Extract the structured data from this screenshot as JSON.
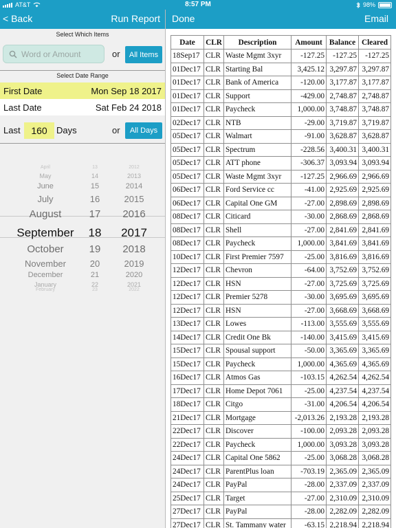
{
  "status": {
    "carrier": "AT&T",
    "time": "8:57 PM",
    "battery": "98%"
  },
  "left_nav": {
    "back": "< Back",
    "run_report": "Run Report"
  },
  "right_nav": {
    "done": "Done",
    "email": "Email"
  },
  "select_items": {
    "label": "Select Which Items",
    "placeholder": "Word or Amount",
    "or": "or",
    "all_items": "All Items"
  },
  "date_range": {
    "label": "Select Date Range",
    "first_label": "First Date",
    "first_value": "Mon Sep 18 2017",
    "last_label": "Last Date",
    "last_value": "Sat Feb 24 2018"
  },
  "last_days": {
    "prefix": "Last",
    "value": "160",
    "suffix": "Days",
    "or": "or",
    "all_days": "All Days"
  },
  "picker": {
    "months": [
      "April",
      "May",
      "June",
      "July",
      "August",
      "September",
      "October",
      "November",
      "December",
      "January",
      "February"
    ],
    "days": [
      "13",
      "14",
      "15",
      "16",
      "17",
      "18",
      "19",
      "20",
      "21",
      "22",
      "23"
    ],
    "years": [
      "2012",
      "2013",
      "2014",
      "2015",
      "2016",
      "2017",
      "2018",
      "2019",
      "2020",
      "2021",
      "2022"
    ]
  },
  "table": {
    "headers": [
      "Date",
      "CLR",
      "Description",
      "Amount",
      "Balance",
      "Cleared"
    ],
    "rows": [
      [
        "18Sep17",
        "CLR",
        "Waste Mgmt 3xyr",
        "-127.25",
        "-127.25",
        "-127.25"
      ],
      [
        "01Dec17",
        "CLR",
        "Starting Bal",
        "3,425.12",
        "3,297.87",
        "3,297.87"
      ],
      [
        "01Dec17",
        "CLR",
        "Bank of America",
        "-120.00",
        "3,177.87",
        "3,177.87"
      ],
      [
        "01Dec17",
        "CLR",
        "Support",
        "-429.00",
        "2,748.87",
        "2,748.87"
      ],
      [
        "01Dec17",
        "CLR",
        "Paycheck",
        "1,000.00",
        "3,748.87",
        "3,748.87"
      ],
      [
        "02Dec17",
        "CLR",
        "NTB",
        "-29.00",
        "3,719.87",
        "3,719.87"
      ],
      [
        "05Dec17",
        "CLR",
        "Walmart",
        "-91.00",
        "3,628.87",
        "3,628.87"
      ],
      [
        "05Dec17",
        "CLR",
        "Spectrum",
        "-228.56",
        "3,400.31",
        "3,400.31"
      ],
      [
        "05Dec17",
        "CLR",
        "ATT phone",
        "-306.37",
        "3,093.94",
        "3,093.94"
      ],
      [
        "05Dec17",
        "CLR",
        "Waste Mgmt 3xyr",
        "-127.25",
        "2,966.69",
        "2,966.69"
      ],
      [
        "06Dec17",
        "CLR",
        "Ford Service cc",
        "-41.00",
        "2,925.69",
        "2,925.69"
      ],
      [
        "06Dec17",
        "CLR",
        "Capital One GM",
        "-27.00",
        "2,898.69",
        "2,898.69"
      ],
      [
        "08Dec17",
        "CLR",
        "Citicard",
        "-30.00",
        "2,868.69",
        "2,868.69"
      ],
      [
        "08Dec17",
        "CLR",
        "Shell",
        "-27.00",
        "2,841.69",
        "2,841.69"
      ],
      [
        "08Dec17",
        "CLR",
        "Paycheck",
        "1,000.00",
        "3,841.69",
        "3,841.69"
      ],
      [
        "10Dec17",
        "CLR",
        "First Premier 7597",
        "-25.00",
        "3,816.69",
        "3,816.69"
      ],
      [
        "12Dec17",
        "CLR",
        "Chevron",
        "-64.00",
        "3,752.69",
        "3,752.69"
      ],
      [
        "12Dec17",
        "CLR",
        "HSN",
        "-27.00",
        "3,725.69",
        "3,725.69"
      ],
      [
        "12Dec17",
        "CLR",
        "Premier 5278",
        "-30.00",
        "3,695.69",
        "3,695.69"
      ],
      [
        "12Dec17",
        "CLR",
        "HSN",
        "-27.00",
        "3,668.69",
        "3,668.69"
      ],
      [
        "13Dec17",
        "CLR",
        "Lowes",
        "-113.00",
        "3,555.69",
        "3,555.69"
      ],
      [
        "14Dec17",
        "CLR",
        "Credit One Bk",
        "-140.00",
        "3,415.69",
        "3,415.69"
      ],
      [
        "15Dec17",
        "CLR",
        "Spousal support",
        "-50.00",
        "3,365.69",
        "3,365.69"
      ],
      [
        "15Dec17",
        "CLR",
        "Paycheck",
        "1,000.00",
        "4,365.69",
        "4,365.69"
      ],
      [
        "16Dec17",
        "CLR",
        "Atmos Gas",
        "-103.15",
        "4,262.54",
        "4,262.54"
      ],
      [
        "17Dec17",
        "CLR",
        "Home Depot 7061",
        "-25.00",
        "4,237.54",
        "4,237.54"
      ],
      [
        "18Dec17",
        "CLR",
        "Citgo",
        "-31.00",
        "4,206.54",
        "4,206.54"
      ],
      [
        "21Dec17",
        "CLR",
        "Mortgage",
        "-2,013.26",
        "2,193.28",
        "2,193.28"
      ],
      [
        "22Dec17",
        "CLR",
        "Discover",
        "-100.00",
        "2,093.28",
        "2,093.28"
      ],
      [
        "22Dec17",
        "CLR",
        "Paycheck",
        "1,000.00",
        "3,093.28",
        "3,093.28"
      ],
      [
        "24Dec17",
        "CLR",
        "Capital One 5862",
        "-25.00",
        "3,068.28",
        "3,068.28"
      ],
      [
        "24Dec17",
        "CLR",
        "ParentPlus loan",
        "-703.19",
        "2,365.09",
        "2,365.09"
      ],
      [
        "24Dec17",
        "CLR",
        "PayPal",
        "-28.00",
        "2,337.09",
        "2,337.09"
      ],
      [
        "25Dec17",
        "CLR",
        "Target",
        "-27.00",
        "2,310.09",
        "2,310.09"
      ],
      [
        "27Dec17",
        "CLR",
        "PayPal",
        "-28.00",
        "2,282.09",
        "2,282.09"
      ],
      [
        "27Dec17",
        "CLR",
        "St. Tammany water",
        "-63.15",
        "2,218.94",
        "2,218.94"
      ]
    ]
  },
  "colors": {
    "accent": "#1c9ec6",
    "highlight": "#eff28a",
    "search_bg": "#cfe9e3",
    "pane_bg": "#f0f0f0"
  },
  "icons": {
    "search": "magnifier-icon",
    "wifi": "wifi-icon",
    "bluetooth": "bluetooth-icon",
    "battery": "battery-icon"
  }
}
